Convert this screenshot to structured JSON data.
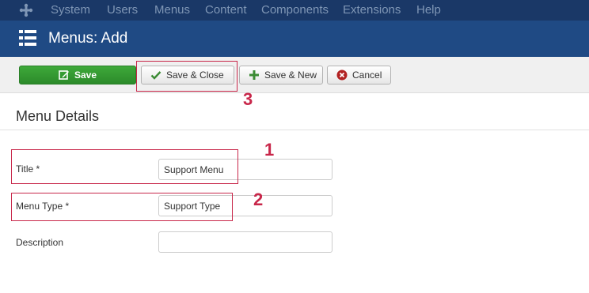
{
  "topnav": {
    "items": [
      "System",
      "Users",
      "Menus",
      "Content",
      "Components",
      "Extensions",
      "Help"
    ]
  },
  "header": {
    "title": "Menus: Add"
  },
  "toolbar": {
    "save_label": "Save",
    "save_close_label": "Save & Close",
    "save_new_label": "Save & New",
    "cancel_label": "Cancel"
  },
  "section": {
    "title": "Menu Details"
  },
  "form": {
    "title_label": "Title *",
    "title_value": "Support Menu",
    "menutype_label": "Menu Type *",
    "menutype_value": "Support Type",
    "description_label": "Description",
    "description_value": ""
  },
  "annotations": [
    "1",
    "2",
    "3"
  ],
  "colors": {
    "topbar": "#1a3867",
    "header": "#1f4a84",
    "save_button": "#2f8f2c",
    "annotation": "#c8274a"
  },
  "icons": {
    "logo": "joomla-logo-icon",
    "header": "list-icon",
    "save": "edit-icon",
    "save_close": "check-icon",
    "save_new": "plus-icon",
    "cancel": "cancel-circle-icon"
  }
}
